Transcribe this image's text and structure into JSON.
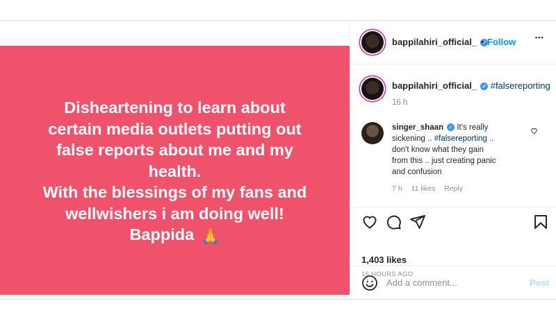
{
  "post": {
    "image_lines": [
      "Disheartening to learn about",
      "certain media outlets putting out",
      "false reports about me and my",
      "health.",
      "With the blessings of my fans and",
      "wellwishers i am doing well!",
      "Bappida"
    ],
    "image_emoji": "🙏",
    "image_bg": "#f0526b"
  },
  "header": {
    "username": "bappilahiri_official_",
    "separator": "•",
    "follow_label": "Follow",
    "more_label": "•••"
  },
  "caption": {
    "username": "bappilahiri_official_",
    "hashtag": "#falsereporting",
    "age": "16 h"
  },
  "comment": {
    "username": "singer_shaan",
    "text_pre": "It's really sickening .. ",
    "hashtag": "#falsereporting",
    "text_post": " .. don't know what they gain from this .. just creating panic and confusion",
    "age": "7 h",
    "likes": "11 likes",
    "reply_label": "Reply"
  },
  "actions": {
    "likes_count": "1,403 likes",
    "timestamp": "16 HOURS AGO"
  },
  "add_comment": {
    "placeholder": "Add a comment...",
    "post_label": "Post"
  },
  "colors": {
    "accent": "#0095f6",
    "verified": "#3897f0"
  }
}
